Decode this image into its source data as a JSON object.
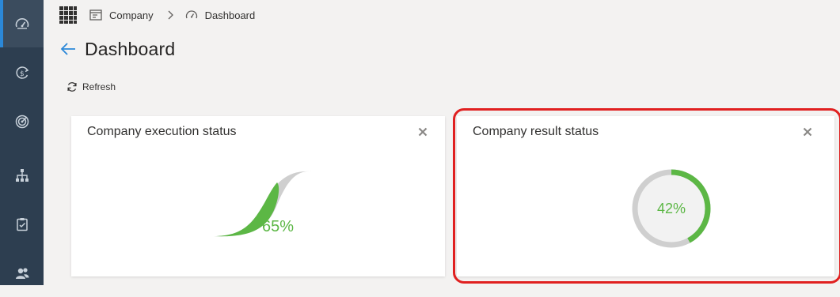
{
  "nav": {
    "items": [
      {
        "icon": "dashboard-icon",
        "active": true
      },
      {
        "icon": "money-cycle-icon",
        "active": false
      },
      {
        "icon": "target-icon",
        "active": false
      },
      {
        "icon": "org-chart-icon",
        "active": false
      },
      {
        "icon": "clipboard-check-icon",
        "active": false
      },
      {
        "icon": "people-icon",
        "active": false
      }
    ]
  },
  "breadcrumb": {
    "company": "Company",
    "dashboard": "Dashboard"
  },
  "page": {
    "title": "Dashboard"
  },
  "commands": {
    "refresh": "Refresh"
  },
  "tiles": {
    "execution": {
      "title": "Company execution status",
      "percent": 65,
      "percent_label": "65%"
    },
    "result": {
      "title": "Company result status",
      "percent": 42,
      "percent_label": "42%"
    }
  },
  "colors": {
    "rail": "#2d3e50",
    "accent": "#2b88d8",
    "progress": "#5cb745",
    "track": "#cfcfcf",
    "highlight": "#e02020"
  }
}
